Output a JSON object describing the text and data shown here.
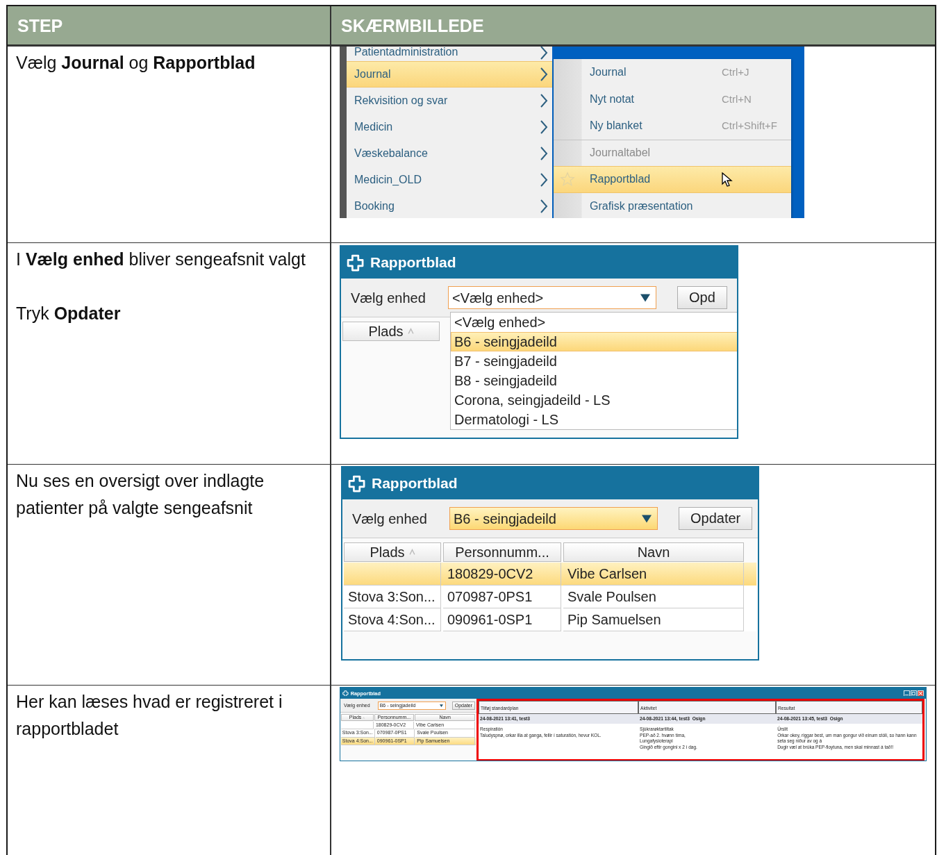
{
  "table": {
    "columns": [
      "STEP",
      "SKÆRMBILLEDE"
    ],
    "rows": [
      {
        "step": [
          "Vælg **Journal** og **Rapportblad**"
        ],
        "screenshot": {
          "kind": "menu",
          "menu": [
            {
              "label": "Patientadministration",
              "selected": false
            },
            {
              "label": "Journal",
              "selected": true
            },
            {
              "label": "Rekvisition og svar",
              "selected": false
            },
            {
              "label": "Medicin",
              "selected": false
            },
            {
              "label": "Væskebalance",
              "selected": false
            },
            {
              "label": "Medicin_OLD",
              "selected": false
            },
            {
              "label": "Booking",
              "selected": false
            }
          ],
          "submenu": [
            {
              "label": "Journal",
              "shortcut": "Ctrl+J",
              "disabled": false,
              "separator": false,
              "selected": false
            },
            {
              "label": "Nyt notat",
              "shortcut": "Ctrl+N",
              "disabled": false,
              "separator": false,
              "selected": false
            },
            {
              "label": "Ny blanket",
              "shortcut": "Ctrl+Shift+F",
              "disabled": false,
              "separator": false,
              "selected": false
            },
            {
              "label": "Journaltabel",
              "disabled": true,
              "separator": true,
              "selected": false
            },
            {
              "label": "Rapportblad",
              "disabled": false,
              "separator": false,
              "selected": true
            },
            {
              "label": "Grafisk præsentation",
              "disabled": false,
              "separator": false,
              "selected": false
            }
          ]
        }
      },
      {
        "step": [
          "I **Vælg enhed** bliver sengeafsnit valgt",
          "Tryk **Opdater**"
        ],
        "screenshot": {
          "kind": "dropdown",
          "title": "Rapportblad",
          "unit_label": "Vælg enhed",
          "unit_select": {
            "value": "<Vælg enhed>",
            "highlighted": false
          },
          "button": "Opd",
          "columns": [
            "Plads"
          ],
          "options": [
            {
              "label": "<Vælg enhed>",
              "selected": false
            },
            {
              "label": "B6 - seingjadeild",
              "selected": true
            },
            {
              "label": "B7 - seingjadeild",
              "selected": false
            },
            {
              "label": "B8 - seingjadeild",
              "selected": false
            },
            {
              "label": "Corona, seingjadeild - LS",
              "selected": false
            },
            {
              "label": "Dermatologi - LS",
              "selected": false
            }
          ]
        }
      },
      {
        "step": [
          "Nu ses en oversigt over indlagte patienter på valgte sengeafsnit"
        ],
        "screenshot": {
          "kind": "list",
          "title": "Rapportblad",
          "unit_label": "Vælg enhed",
          "unit_select": {
            "value": "B6 - seingjadeild",
            "highlighted": true
          },
          "button": "Opdater",
          "columns": [
            "Plads",
            "Personnumm...",
            "Navn"
          ],
          "rows": [
            {
              "cells": [
                "",
                "180829-0CV2",
                "Vibe Carlsen"
              ],
              "selected": true
            },
            {
              "cells": [
                "Stova 3:Son...",
                "070987-0PS1",
                "Svale Poulsen"
              ],
              "selected": false
            },
            {
              "cells": [
                "Stova 4:Son...",
                "090961-0SP1",
                "Pip Samuelsen"
              ],
              "selected": false
            }
          ]
        }
      },
      {
        "step": [
          "Her kan læses hvad er registreret i rapportbladet"
        ],
        "screenshot": {
          "kind": "report",
          "title": "Rapportblad",
          "unit_label": "Vælg enhed",
          "unit_select": {
            "value": "B6 - seingjadeild",
            "highlighted": false
          },
          "button": "Opdater",
          "columns": [
            "Plads",
            "Personnumm...",
            "Navn"
          ],
          "rows": [
            {
              "cells": [
                "",
                "180829-0CV2",
                "Vibe Carlsen"
              ],
              "selected": false
            },
            {
              "cells": [
                "Stova 3:Son...",
                "070987-0PS1",
                "Svale Poulsen"
              ],
              "selected": false
            },
            {
              "cells": [
                "Stova 4:Son...",
                "090961-0SP1",
                "Pip Samuelsen"
              ],
              "selected": true
            }
          ],
          "report": {
            "columns": [
              "Tilføj standardplan",
              "Aktivitet",
              "Resultat"
            ],
            "entries": [
              {
                "header": "24-08-2021 13:41, test3",
                "lines": [
                  "Respiratión",
                  "Taludyspnø, orkar illa at ganga, fellir í saturatión, hevur KOL."
                ]
              },
              {
                "header": "24-08-2021 13:44, test3  Osign",
                "lines": [
                  "Sjúkrarøktartiltak",
                  "PEP-að 2. hvønn tíma,",
                  "Lungafysioterapi",
                  "Gingið eftir gongini x 2 í dag."
                ]
              },
              {
                "header": "24-08-2021 13:45, test3  Osign",
                "lines": [
                  "Úrslit",
                  "Orkar okey, riggar best, um man gongur við einum stóli, so hann kann seta seg niður av og á",
                  "Dugir væl at brúka PEP-floytuna, men skal minnast á tað!!"
                ]
              }
            ]
          }
        }
      }
    ]
  }
}
